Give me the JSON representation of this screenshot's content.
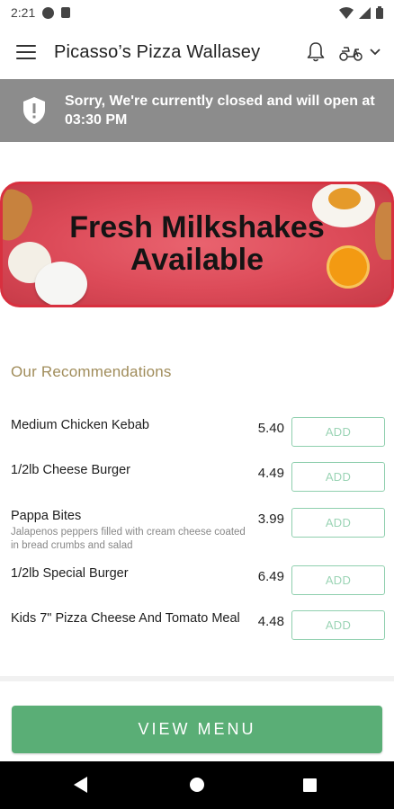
{
  "status_bar": {
    "time": "2:21"
  },
  "app_bar": {
    "title": "Picasso’s Pizza Wallasey"
  },
  "closed_banner": {
    "message": "Sorry, We're currently closed and will open at 03:30 PM"
  },
  "promo": {
    "line1": "Fresh Milkshakes",
    "line2": "Available"
  },
  "recommendations": {
    "heading": "Our Recommendations",
    "items": [
      {
        "name": "Medium Chicken Kebab",
        "description": "",
        "price": "5.40",
        "add_label": "ADD"
      },
      {
        "name": "1/2lb Cheese Burger",
        "description": "",
        "price": "4.49",
        "add_label": "ADD"
      },
      {
        "name": "Pappa Bites",
        "description": "Jalapenos peppers filled with cream cheese coated in bread crumbs and salad",
        "price": "3.99",
        "add_label": "ADD"
      },
      {
        "name": "1/2lb Special Burger",
        "description": "",
        "price": "6.49",
        "add_label": "ADD"
      },
      {
        "name": "Kids 7\" Pizza Cheese And Tomato Meal",
        "description": "",
        "price": "4.48",
        "add_label": "ADD"
      }
    ]
  },
  "view_menu_label": "VIEW MENU",
  "colors": {
    "banner_gray": "#8c8c8c",
    "accent_green": "#5aae76",
    "heading_gold": "#a08c5a",
    "promo_red": "#dc4a58"
  },
  "icons": [
    "menu-icon",
    "bell-icon",
    "scooter-icon",
    "chevron-down-icon",
    "shield-alert-icon",
    "wifi-icon",
    "signal-icon",
    "battery-icon",
    "back-icon",
    "home-icon",
    "recents-icon"
  ]
}
